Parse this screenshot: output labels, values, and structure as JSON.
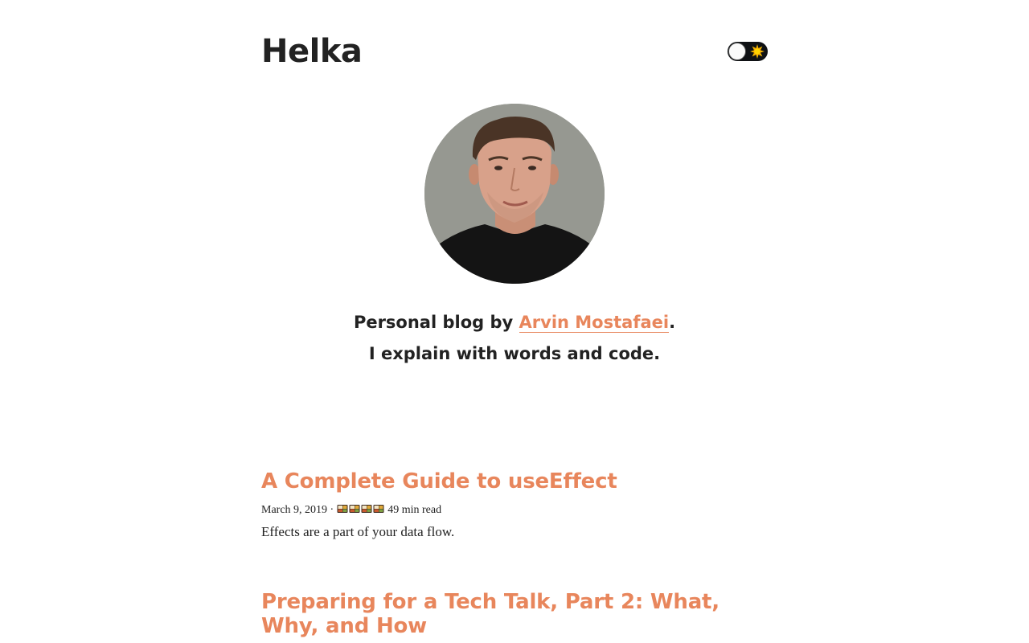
{
  "header": {
    "site_title": "Helka",
    "theme_toggle": {
      "state": "light",
      "icon": "sun-icon"
    }
  },
  "profile": {
    "avatar_alt": "Arvin Mostafaei"
  },
  "bio": {
    "prefix": "Personal blog by ",
    "author_name": "Arvin Mostafaei",
    "suffix": ".",
    "tagline": "I explain with words and code."
  },
  "posts": [
    {
      "title": "A Complete Guide to useEffect",
      "date": "March 9, 2019",
      "separator": " · ",
      "read_icons": [
        "bento-icon",
        "bento-icon",
        "bento-icon",
        "bento-icon"
      ],
      "read_time": "49 min read",
      "excerpt": "Effects are a part of your data flow."
    },
    {
      "title": "Preparing for a Tech Talk, Part 2: What, Why, and How"
    }
  ],
  "colors": {
    "accent": "#e8865c",
    "text": "#222222",
    "background": "#ffffff",
    "toggle_track": "#0f1114"
  }
}
